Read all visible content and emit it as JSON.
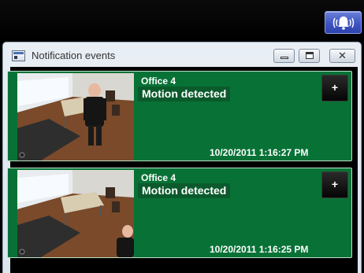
{
  "window": {
    "title": "Notification events"
  },
  "toolbar": {
    "alarm_icon": "alarm-bell-icon",
    "accent_color": "#3f55c2"
  },
  "notifications": [
    {
      "camera": "Office 4",
      "event": "Motion detected",
      "timestamp": "10/20/2011 1:16:27 PM",
      "add_label": "+"
    },
    {
      "camera": "Office 4",
      "event": "Motion detected",
      "timestamp": "10/20/2011 1:16:25 PM",
      "add_label": "+"
    }
  ],
  "colors": {
    "card_background": "#087236",
    "card_border": "#bfe0c8"
  }
}
